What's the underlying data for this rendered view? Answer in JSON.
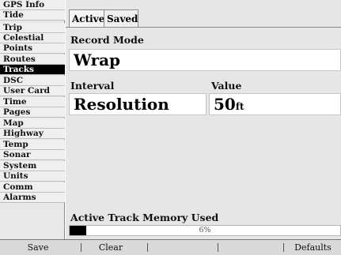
{
  "sidebar": {
    "items": [
      {
        "label": "GPS Info",
        "selected": false
      },
      {
        "label": "Tide",
        "selected": false
      },
      {
        "label": "Trip",
        "selected": false
      },
      {
        "label": "Celestial",
        "selected": false
      },
      {
        "label": "Points",
        "selected": false
      },
      {
        "label": "Routes",
        "selected": false
      },
      {
        "label": "Tracks",
        "selected": true
      },
      {
        "label": "DSC",
        "selected": false
      },
      {
        "label": "User Card",
        "selected": false
      },
      {
        "label": "Time",
        "selected": false
      },
      {
        "label": "Pages",
        "selected": false
      },
      {
        "label": "Map",
        "selected": false
      },
      {
        "label": "Highway",
        "selected": false
      },
      {
        "label": "Temp",
        "selected": false
      },
      {
        "label": "Sonar",
        "selected": false
      },
      {
        "label": "System",
        "selected": false
      },
      {
        "label": "Units",
        "selected": false
      },
      {
        "label": "Comm",
        "selected": false
      },
      {
        "label": "Alarms",
        "selected": false
      }
    ]
  },
  "tabs": [
    {
      "label": "Active",
      "active": true
    },
    {
      "label": "Saved",
      "active": false
    }
  ],
  "record_mode": {
    "label": "Record Mode",
    "value": "Wrap"
  },
  "interval": {
    "label": "Interval",
    "value": "Resolution"
  },
  "value_field": {
    "label": "Value",
    "value": "50",
    "unit": "ft"
  },
  "memory": {
    "label": "Active Track Memory Used",
    "percent_text": "6%",
    "fraction": 0.06
  },
  "softkeys": {
    "save": "Save",
    "clear": "Clear",
    "defaults": "Defaults"
  }
}
